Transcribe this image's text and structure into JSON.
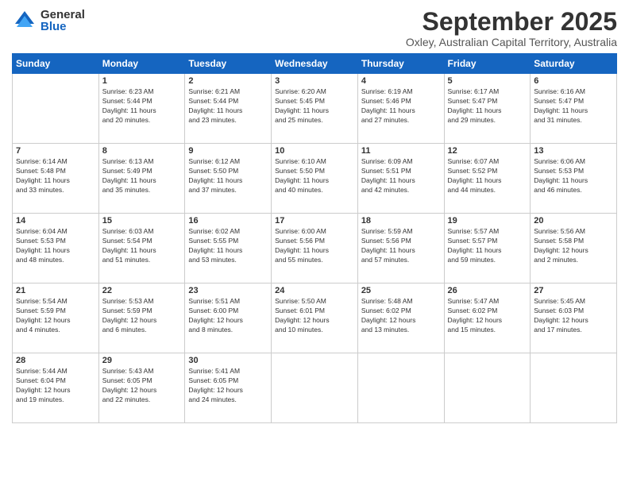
{
  "header": {
    "logo_general": "General",
    "logo_blue": "Blue",
    "month_title": "September 2025",
    "subtitle": "Oxley, Australian Capital Territory, Australia"
  },
  "days_of_week": [
    "Sunday",
    "Monday",
    "Tuesday",
    "Wednesday",
    "Thursday",
    "Friday",
    "Saturday"
  ],
  "weeks": [
    [
      {
        "day": "",
        "info": ""
      },
      {
        "day": "1",
        "info": "Sunrise: 6:23 AM\nSunset: 5:44 PM\nDaylight: 11 hours\nand 20 minutes."
      },
      {
        "day": "2",
        "info": "Sunrise: 6:21 AM\nSunset: 5:44 PM\nDaylight: 11 hours\nand 23 minutes."
      },
      {
        "day": "3",
        "info": "Sunrise: 6:20 AM\nSunset: 5:45 PM\nDaylight: 11 hours\nand 25 minutes."
      },
      {
        "day": "4",
        "info": "Sunrise: 6:19 AM\nSunset: 5:46 PM\nDaylight: 11 hours\nand 27 minutes."
      },
      {
        "day": "5",
        "info": "Sunrise: 6:17 AM\nSunset: 5:47 PM\nDaylight: 11 hours\nand 29 minutes."
      },
      {
        "day": "6",
        "info": "Sunrise: 6:16 AM\nSunset: 5:47 PM\nDaylight: 11 hours\nand 31 minutes."
      }
    ],
    [
      {
        "day": "7",
        "info": "Sunrise: 6:14 AM\nSunset: 5:48 PM\nDaylight: 11 hours\nand 33 minutes."
      },
      {
        "day": "8",
        "info": "Sunrise: 6:13 AM\nSunset: 5:49 PM\nDaylight: 11 hours\nand 35 minutes."
      },
      {
        "day": "9",
        "info": "Sunrise: 6:12 AM\nSunset: 5:50 PM\nDaylight: 11 hours\nand 37 minutes."
      },
      {
        "day": "10",
        "info": "Sunrise: 6:10 AM\nSunset: 5:50 PM\nDaylight: 11 hours\nand 40 minutes."
      },
      {
        "day": "11",
        "info": "Sunrise: 6:09 AM\nSunset: 5:51 PM\nDaylight: 11 hours\nand 42 minutes."
      },
      {
        "day": "12",
        "info": "Sunrise: 6:07 AM\nSunset: 5:52 PM\nDaylight: 11 hours\nand 44 minutes."
      },
      {
        "day": "13",
        "info": "Sunrise: 6:06 AM\nSunset: 5:53 PM\nDaylight: 11 hours\nand 46 minutes."
      }
    ],
    [
      {
        "day": "14",
        "info": "Sunrise: 6:04 AM\nSunset: 5:53 PM\nDaylight: 11 hours\nand 48 minutes."
      },
      {
        "day": "15",
        "info": "Sunrise: 6:03 AM\nSunset: 5:54 PM\nDaylight: 11 hours\nand 51 minutes."
      },
      {
        "day": "16",
        "info": "Sunrise: 6:02 AM\nSunset: 5:55 PM\nDaylight: 11 hours\nand 53 minutes."
      },
      {
        "day": "17",
        "info": "Sunrise: 6:00 AM\nSunset: 5:56 PM\nDaylight: 11 hours\nand 55 minutes."
      },
      {
        "day": "18",
        "info": "Sunrise: 5:59 AM\nSunset: 5:56 PM\nDaylight: 11 hours\nand 57 minutes."
      },
      {
        "day": "19",
        "info": "Sunrise: 5:57 AM\nSunset: 5:57 PM\nDaylight: 11 hours\nand 59 minutes."
      },
      {
        "day": "20",
        "info": "Sunrise: 5:56 AM\nSunset: 5:58 PM\nDaylight: 12 hours\nand 2 minutes."
      }
    ],
    [
      {
        "day": "21",
        "info": "Sunrise: 5:54 AM\nSunset: 5:59 PM\nDaylight: 12 hours\nand 4 minutes."
      },
      {
        "day": "22",
        "info": "Sunrise: 5:53 AM\nSunset: 5:59 PM\nDaylight: 12 hours\nand 6 minutes."
      },
      {
        "day": "23",
        "info": "Sunrise: 5:51 AM\nSunset: 6:00 PM\nDaylight: 12 hours\nand 8 minutes."
      },
      {
        "day": "24",
        "info": "Sunrise: 5:50 AM\nSunset: 6:01 PM\nDaylight: 12 hours\nand 10 minutes."
      },
      {
        "day": "25",
        "info": "Sunrise: 5:48 AM\nSunset: 6:02 PM\nDaylight: 12 hours\nand 13 minutes."
      },
      {
        "day": "26",
        "info": "Sunrise: 5:47 AM\nSunset: 6:02 PM\nDaylight: 12 hours\nand 15 minutes."
      },
      {
        "day": "27",
        "info": "Sunrise: 5:45 AM\nSunset: 6:03 PM\nDaylight: 12 hours\nand 17 minutes."
      }
    ],
    [
      {
        "day": "28",
        "info": "Sunrise: 5:44 AM\nSunset: 6:04 PM\nDaylight: 12 hours\nand 19 minutes."
      },
      {
        "day": "29",
        "info": "Sunrise: 5:43 AM\nSunset: 6:05 PM\nDaylight: 12 hours\nand 22 minutes."
      },
      {
        "day": "30",
        "info": "Sunrise: 5:41 AM\nSunset: 6:05 PM\nDaylight: 12 hours\nand 24 minutes."
      },
      {
        "day": "",
        "info": ""
      },
      {
        "day": "",
        "info": ""
      },
      {
        "day": "",
        "info": ""
      },
      {
        "day": "",
        "info": ""
      }
    ]
  ]
}
